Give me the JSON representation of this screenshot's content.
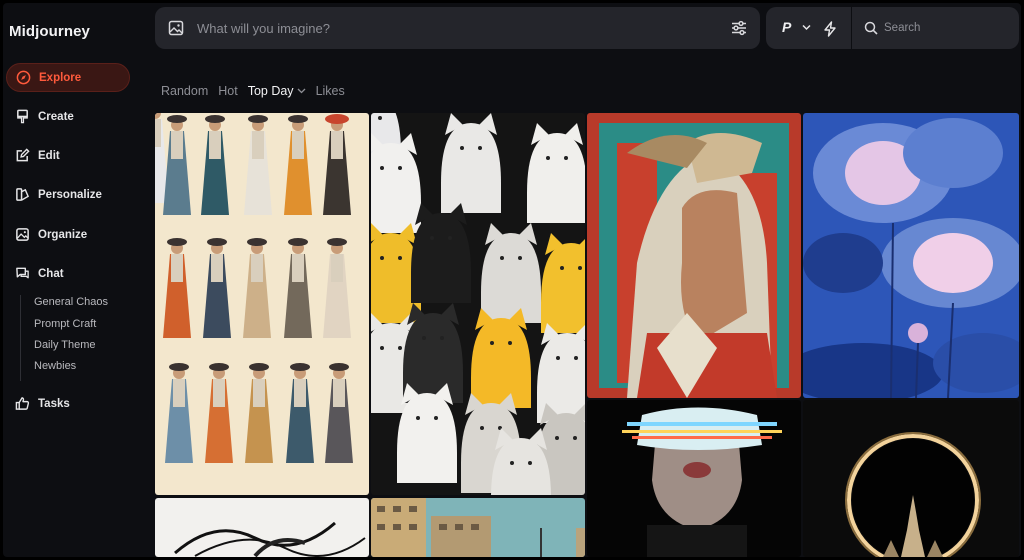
{
  "app": {
    "title": "Midjourney"
  },
  "sidebar": {
    "items": [
      {
        "label": "Explore",
        "icon": "compass-icon",
        "active": true
      },
      {
        "label": "Create",
        "icon": "brush-icon"
      },
      {
        "label": "Edit",
        "icon": "edit-icon"
      },
      {
        "label": "Personalize",
        "icon": "palette-icon"
      },
      {
        "label": "Organize",
        "icon": "image-icon"
      },
      {
        "label": "Chat",
        "icon": "chat-icon"
      },
      {
        "label": "Tasks",
        "icon": "thumbs-up-icon"
      }
    ],
    "chat_rooms": [
      "General Chaos",
      "Prompt Craft",
      "Daily Theme",
      "Newbies"
    ]
  },
  "topbar": {
    "prompt_placeholder": "What will you imagine?",
    "version_label": "P",
    "search_placeholder": "Search"
  },
  "tabs": [
    {
      "label": "Random",
      "active": false
    },
    {
      "label": "Hot",
      "active": false
    },
    {
      "label": "Top Day",
      "active": true,
      "dropdown": true
    },
    {
      "label": "Likes",
      "active": false
    }
  ],
  "colors": {
    "accent": "#ff5a3c",
    "background": "#0d0e12",
    "panel": "#24252b"
  },
  "gallery": [
    {
      "subject": "vintage fashion illustration plate"
    },
    {
      "subject": "cute round cats pattern"
    },
    {
      "subject": "hooded warrior with winged helmet"
    },
    {
      "subject": "blue lotus flowers"
    },
    {
      "subject": "woman with glowing light visor"
    },
    {
      "subject": "eclipse over spired cathedral"
    },
    {
      "subject": "ink brush strokes"
    },
    {
      "subject": "apartment buildings"
    }
  ]
}
